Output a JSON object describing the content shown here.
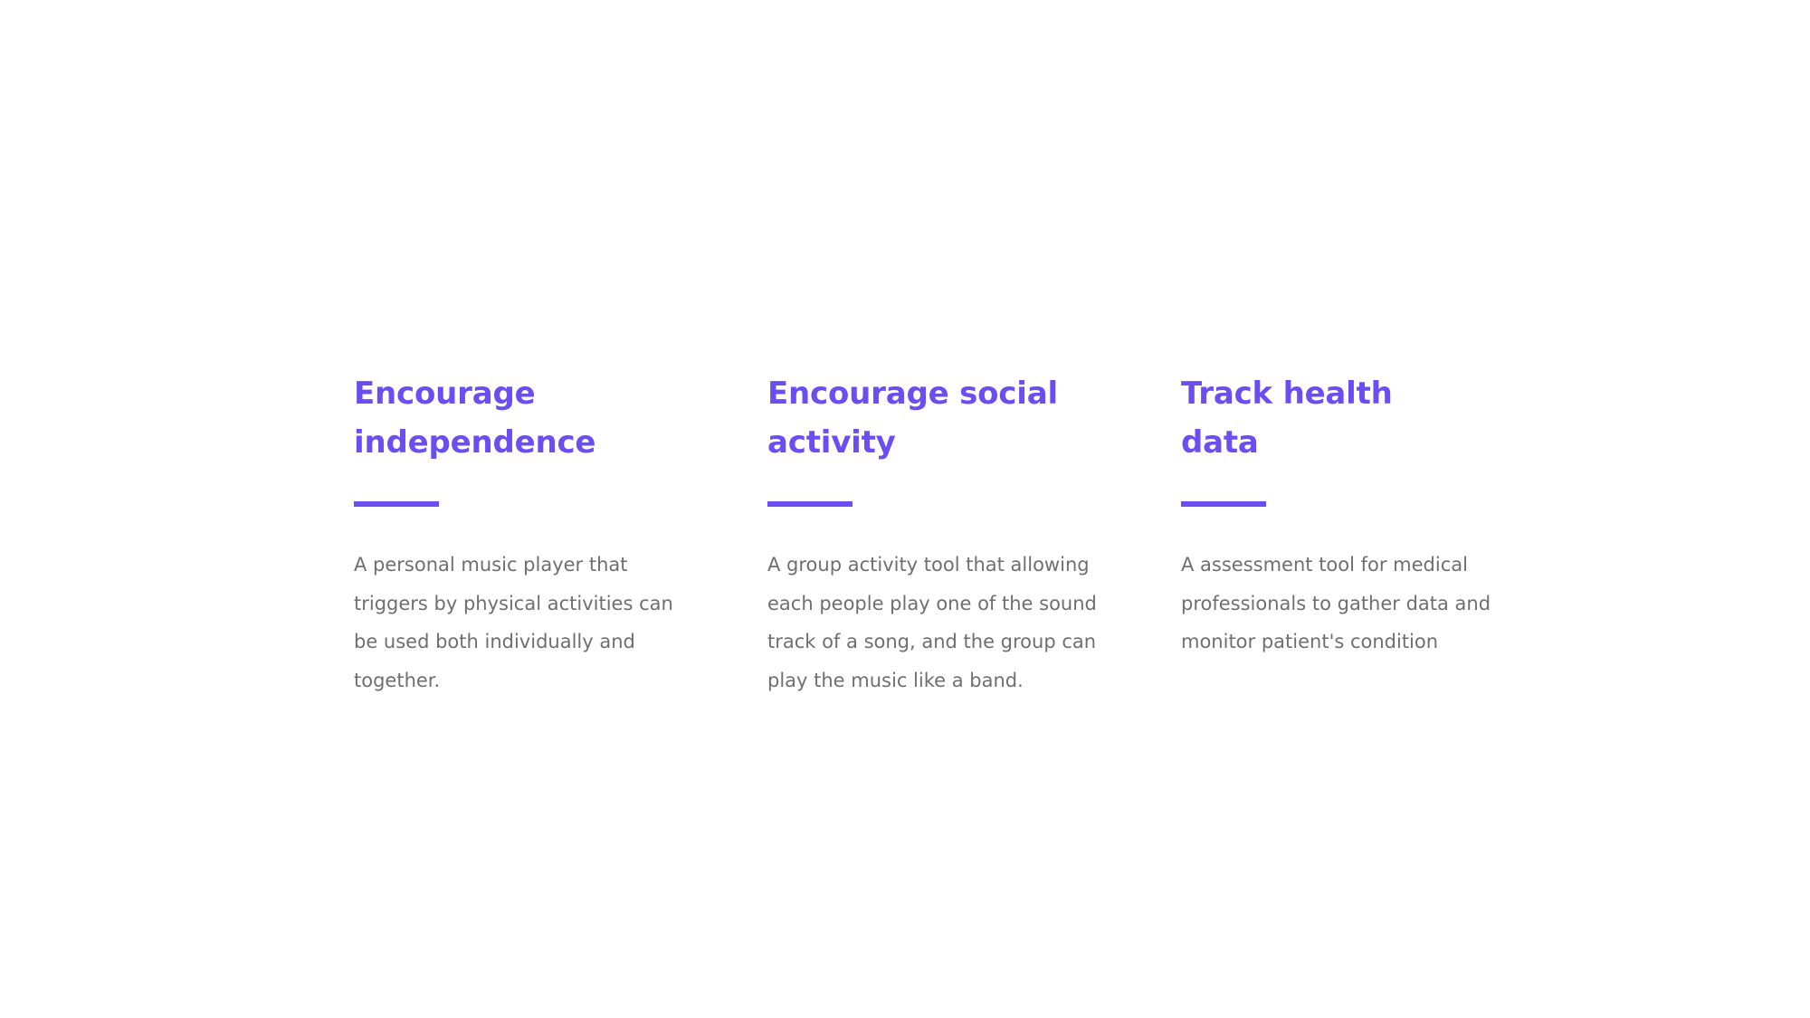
{
  "features": [
    {
      "title_lines": [
        "Encourage",
        "independence"
      ],
      "description_lines": [
        "A personal music player that",
        "triggers by physical activities can",
        "be used both individually and",
        "together."
      ]
    },
    {
      "title_lines": [
        "Encourage social",
        "activity"
      ],
      "description_lines": [
        "A group activity tool that allowing",
        "each people play one of the sound",
        "track of a song, and the group can",
        "play the music like a band."
      ]
    },
    {
      "title_lines": [
        "Track health",
        "data"
      ],
      "description_lines": [
        "A assessment tool for medical",
        "professionals to gather data and",
        "monitor patient's condition"
      ]
    }
  ],
  "colors": {
    "accent": "#6b4ef2",
    "body_text": "#6f6f6f",
    "background": "#ffffff"
  }
}
